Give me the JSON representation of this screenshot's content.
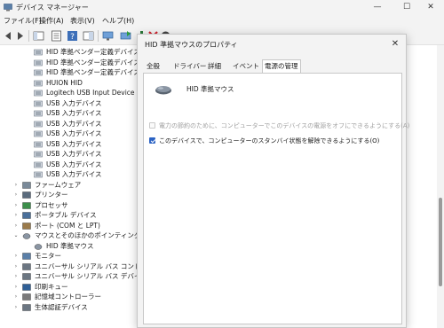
{
  "window": {
    "title": "デバイス マネージャー",
    "controls": {
      "minimize": "—",
      "maximize": "☐",
      "close": "✕"
    }
  },
  "menu": [
    "ファイル(F)",
    "操作(A)",
    "表示(V)",
    "ヘルプ(H)"
  ],
  "toolbar": {
    "buttons": [
      "back-icon",
      "forward-icon",
      "show-hide-tree-icon",
      "properties-icon",
      "help-icon",
      "console-tree-icon",
      "monitor-icon",
      "update-driver-icon",
      "scan-hardware-icon",
      "uninstall-icon",
      "disable-icon"
    ]
  },
  "tree": {
    "hid_children": [
      "HID 準拠ベンダー定義デバイス",
      "HID 準拠ベンダー定義デバイス",
      "HID 準拠ベンダー定義デバイス",
      "HUION HID",
      "Logitech USB Input Device",
      "USB 入力デバイス",
      "USB 入力デバイス",
      "USB 入力デバイス",
      "USB 入力デバイス",
      "USB 入力デバイス",
      "USB 入力デバイス",
      "USB 入力デバイス",
      "USB 入力デバイス"
    ],
    "categories_before": [
      "ファームウェア",
      "プリンター",
      "プロセッサ",
      "ポータブル デバイス",
      "ポート (COM と LPT)"
    ],
    "expanded_category": "マウスとそのほかのポインティング デバイス",
    "expanded_child": "HID 準拠マウス",
    "categories_after": [
      "モニター",
      "ユニバーサル シリアル バス コントローラー",
      "ユニバーサル シリアル バス デバイス",
      "印刷キュー",
      "記憶域コントローラー",
      "生体認証デバイス"
    ],
    "expand_arrow": "›",
    "collapse_arrow": "⌄"
  },
  "dialog": {
    "title": "HID 準拠マウスのプロパティ",
    "close": "✕",
    "tabs": [
      "全般",
      "ドライバー",
      "詳細",
      "イベント",
      "電源の管理"
    ],
    "active_tab": 4,
    "device_name": "HID 準拠マウス",
    "options": [
      {
        "label": "電力の節約のために、コンピューターでこのデバイスの電源をオフにできるようにする(A)",
        "checked": false,
        "enabled": false
      },
      {
        "label": "このデバイスで、コンピューターのスタンバイ状態を解除できるようにする(O)",
        "checked": true,
        "enabled": true
      }
    ]
  },
  "colors": {
    "accent": "#2b63c4",
    "window_bg": "#f3f3f3",
    "panel_bg": "#ffffff"
  }
}
